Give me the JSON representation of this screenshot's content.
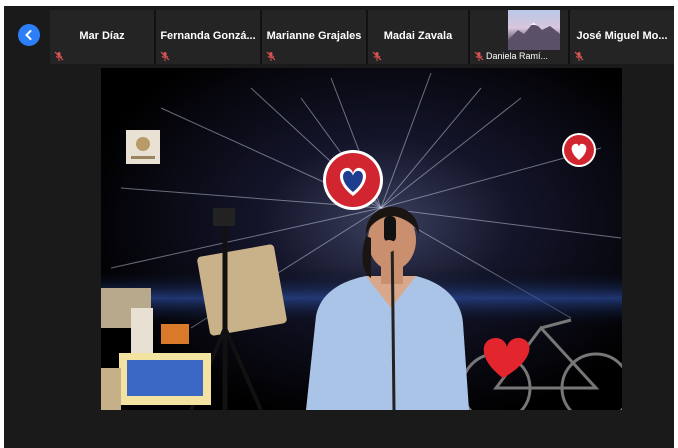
{
  "participants": [
    {
      "name": "Mar Díaz"
    },
    {
      "name": "Fernanda  Gonzá..."
    },
    {
      "name": "Marianne Grajales"
    },
    {
      "name": "Madai Zavala"
    },
    {
      "name": "Daniela Ramí..."
    },
    {
      "name": "José  Miguel  Mo..."
    }
  ],
  "colors": {
    "nav_button": "#2d7ff9",
    "muted_mic": "#d9534f",
    "strip_bg": "#1a1a1a"
  },
  "icons": {
    "nav_prev": "chevron-left-icon",
    "mic": "mic-off-icon"
  }
}
